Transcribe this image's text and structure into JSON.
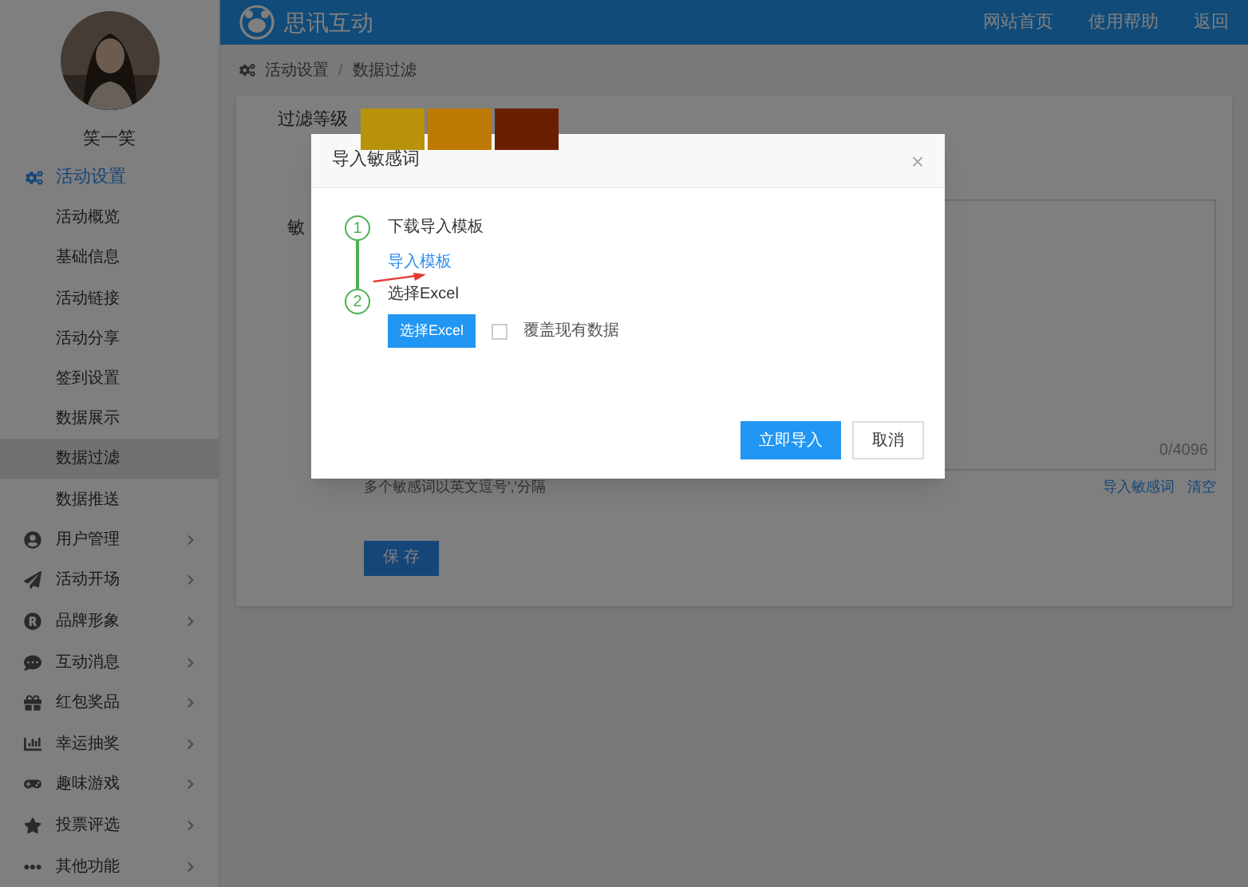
{
  "sidebar": {
    "user_name": "笑一笑",
    "group": {
      "label": "活动设置",
      "expanded": true,
      "items": [
        {
          "label": "活动概览",
          "selected": false
        },
        {
          "label": "基础信息",
          "selected": false
        },
        {
          "label": "活动链接",
          "selected": false
        },
        {
          "label": "活动分享",
          "selected": false
        },
        {
          "label": "签到设置",
          "selected": false
        },
        {
          "label": "数据展示",
          "selected": false
        },
        {
          "label": "数据过滤",
          "selected": true
        },
        {
          "label": "数据推送",
          "selected": false
        }
      ]
    },
    "menu": [
      {
        "label": "用户管理"
      },
      {
        "label": "活动开场"
      },
      {
        "label": "品牌形象"
      },
      {
        "label": "互动消息"
      },
      {
        "label": "红包奖品"
      },
      {
        "label": "幸运抽奖"
      },
      {
        "label": "趣味游戏"
      },
      {
        "label": "投票评选"
      },
      {
        "label": "其他功能"
      }
    ]
  },
  "header": {
    "brand": "思讯互动",
    "links": [
      "网站首页",
      "使用帮助",
      "返回"
    ]
  },
  "breadcrumb": [
    "活动设置",
    "/",
    "数据过滤"
  ],
  "form": {
    "level_label": "过滤等级",
    "levels": [
      {
        "color": "#b8920a"
      },
      {
        "color": "#bd7a05"
      },
      {
        "color": "#6a2000"
      }
    ],
    "words_label": "敏",
    "counter": "0/4096",
    "hint": "多个敏感词以英文逗号','分隔",
    "links": [
      "导入敏感词",
      "清空"
    ],
    "save": "保 存"
  },
  "dialog": {
    "title": "导入敏感词",
    "close": "×",
    "steps": [
      {
        "number": "1",
        "label": "下载导入模板",
        "link": "导入模板"
      },
      {
        "number": "2",
        "label": "选择Excel",
        "button": "选择Excel"
      }
    ],
    "overwrite": {
      "label": "覆盖现有数据",
      "checked": false
    },
    "buttons": {
      "confirm": "立即导入",
      "cancel": "取消"
    }
  }
}
